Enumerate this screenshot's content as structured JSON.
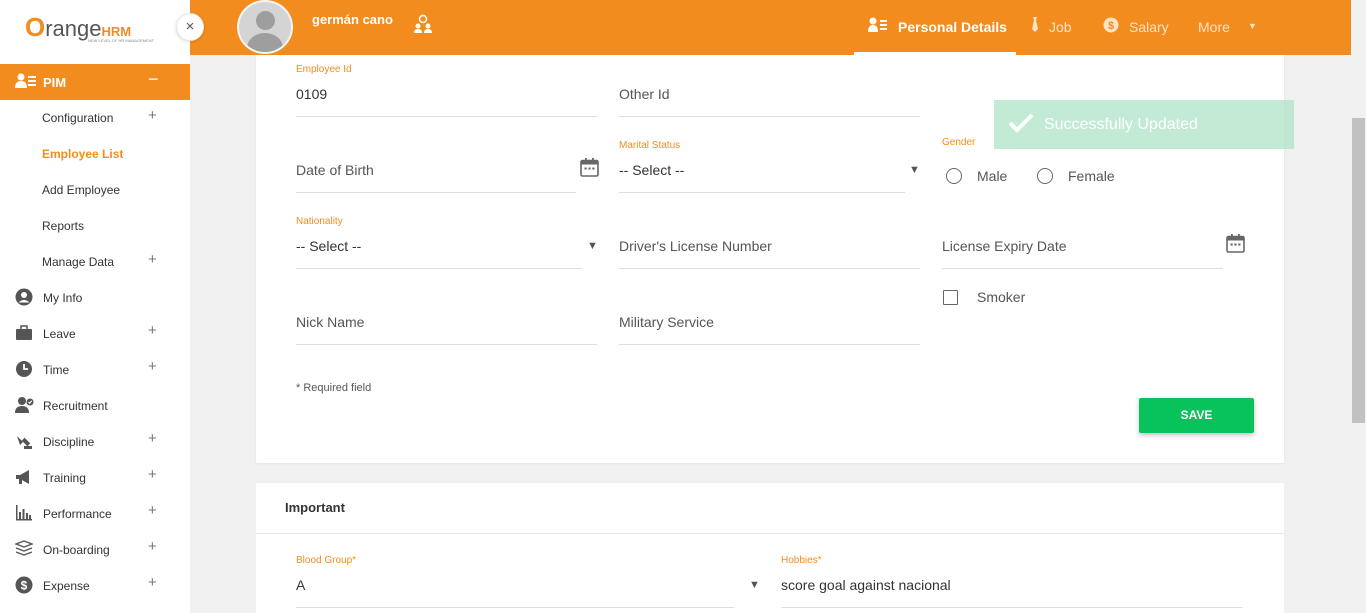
{
  "brand": {
    "logo_text_o": "O",
    "logo_text": "range",
    "logo_hrm": "HRM",
    "tagline": "NEW LEVEL OF HR MANAGEMENT",
    "accent": "#f28c1e"
  },
  "sidebar": {
    "close": "×",
    "pim": {
      "label": "PIM",
      "toggle": "−"
    },
    "pim_sub": [
      {
        "label": "Configuration",
        "plus": "+"
      },
      {
        "label": "Employee List"
      },
      {
        "label": "Add Employee"
      },
      {
        "label": "Reports"
      },
      {
        "label": "Manage Data",
        "plus": "+"
      }
    ],
    "items": [
      {
        "label": "My Info",
        "icon": "person-icon"
      },
      {
        "label": "Leave",
        "icon": "briefcase-icon",
        "plus": "+"
      },
      {
        "label": "Time",
        "icon": "clock-icon",
        "plus": "+"
      },
      {
        "label": "Recruitment",
        "icon": "recruitment-icon"
      },
      {
        "label": "Discipline",
        "icon": "discipline-icon",
        "plus": "+"
      },
      {
        "label": "Training",
        "icon": "megaphone-icon",
        "plus": "+"
      },
      {
        "label": "Performance",
        "icon": "bar-chart-icon",
        "plus": "+"
      },
      {
        "label": "On-boarding",
        "icon": "stack-icon",
        "plus": "+"
      },
      {
        "label": "Expense",
        "icon": "dollar-icon",
        "plus": "+"
      }
    ]
  },
  "header": {
    "employee_name": "germán cano",
    "tabs": [
      {
        "label": "Personal Details"
      },
      {
        "label": "Job"
      },
      {
        "label": "Salary"
      },
      {
        "label": "More"
      }
    ]
  },
  "form": {
    "employee_id": {
      "label": "Employee Id",
      "value": "0109"
    },
    "other_id": {
      "placeholder": "Other Id"
    },
    "date_of_birth": {
      "placeholder": "Date of Birth"
    },
    "marital_status": {
      "label": "Marital Status",
      "value": "-- Select --"
    },
    "gender": {
      "label": "Gender",
      "male": "Male",
      "female": "Female"
    },
    "nationality": {
      "label": "Nationality",
      "value": "-- Select --"
    },
    "drivers_license": {
      "placeholder": "Driver's License Number"
    },
    "license_expiry": {
      "placeholder": "License Expiry Date"
    },
    "smoker": {
      "label": "Smoker"
    },
    "nick_name": {
      "placeholder": "Nick Name"
    },
    "military_service": {
      "placeholder": "Military Service"
    },
    "required_note": "* Required field",
    "save_label": "SAVE"
  },
  "toast": {
    "message": "Successfully Updated"
  },
  "important": {
    "title": "Important",
    "blood_group": {
      "label": "Blood Group",
      "required": "*",
      "value": "A"
    },
    "hobbies": {
      "label": "Hobbies",
      "required": "*",
      "value": "score goal against nacional"
    }
  }
}
